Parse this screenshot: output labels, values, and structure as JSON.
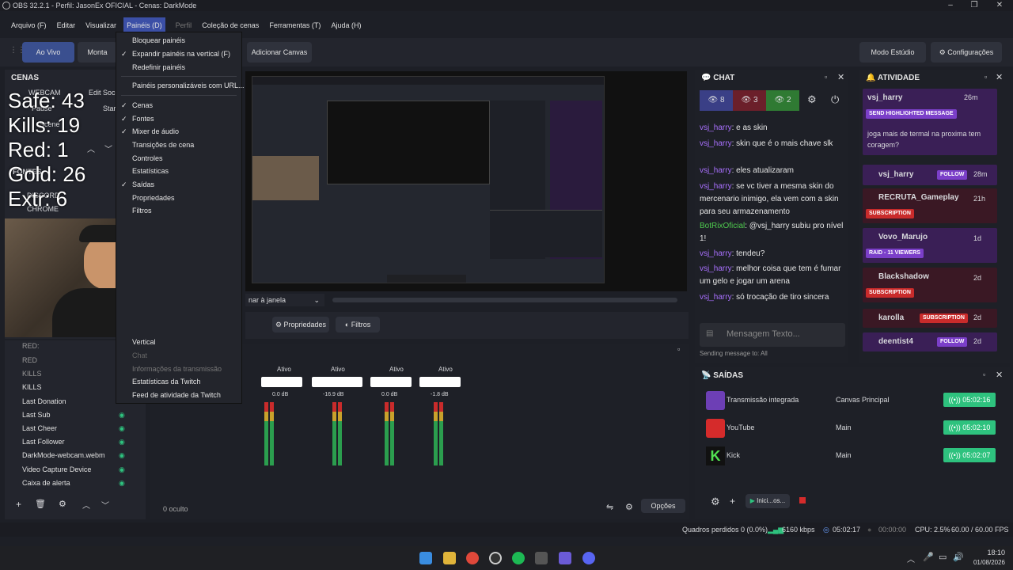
{
  "window": {
    "title": "OBS 32.2.1 - Perfil: JasonEx OFICIAL - Cenas: DarkMode",
    "min": "–",
    "max": "❐",
    "close": "✕"
  },
  "menu": {
    "items": [
      "Arquivo (F)",
      "Editar",
      "Visualizar",
      "Painéis (D)",
      "Perfil",
      "Coleção de cenas",
      "Ferramentas (T)",
      "Ajuda (H)"
    ]
  },
  "toolbar": {
    "live": "Ao Vivo",
    "montage": "Monta",
    "add_canvas": "Adicionar Canvas",
    "studio": "Modo Estúdio",
    "config": "Configurações"
  },
  "dropdown": {
    "items": [
      "Bloquear painéis",
      "Expandir painéis na vertical (F)",
      "Redefinir painéis",
      "Painéis personalizáveis com URL...",
      "Cenas",
      "Fontes",
      "Mixer de áudio",
      "Transições de cena",
      "Controles",
      "Estatísticas",
      "Saídas",
      "Propriedades",
      "Filtros",
      "Vertical",
      "Chat",
      "Informações da transmissão",
      "Estatísticas da Twitch",
      "Feed de atividade da Twitch"
    ]
  },
  "scenes": {
    "title": "CENAS",
    "items": [
      "WEBCAM",
      "Edit Soci",
      "Pause",
      "Star",
      "Scene",
      "FONTES",
      "DISCORD",
      "CHROME"
    ]
  },
  "overlay": {
    "safe": "Safe: 43",
    "kills": "Kills: 19",
    "red": "Red:   1",
    "gold": "Gold: 26",
    "extr": "Extr:  6"
  },
  "sources": {
    "items": [
      "RED:",
      "RED",
      "KILLS",
      "KILLS",
      "Last Donation",
      "Last Sub",
      "Last Cheer",
      "Last Follower",
      "DarkMode-webcam.webm",
      "Video Capture Device",
      "Caixa de alerta"
    ]
  },
  "preview": {
    "window_label": "nar à janela",
    "props": "Propriedades",
    "filters": "Filtros"
  },
  "chat": {
    "title": "CHAT",
    "viewers": [
      "8",
      "3",
      "2"
    ],
    "lines": [
      {
        "user": "vsj_harry",
        "text": ": e as skin"
      },
      {
        "user": "vsj_harry",
        "text": ": skin que é o mais chave slk"
      },
      {
        "user": "vsj_harry",
        "text": ": eles atualizaram"
      },
      {
        "user": "vsj_harry",
        "text": ": se vc tiver a mesma skin do mercenario inimigo, ela vem com a skin para seu armazenamento"
      },
      {
        "user": "BotRixOficial",
        "text": ": @vsj_harry subiu pro nível 1!"
      },
      {
        "user": "vsj_harry",
        "text": ": tendeu?"
      },
      {
        "user": "vsj_harry",
        "text": ": melhor coisa que tem é fumar um gelo e jogar um arena"
      },
      {
        "user": "vsj_harry",
        "text": ": só trocação de tiro sincera"
      }
    ],
    "input_placeholder": "Mensagem Texto...",
    "sending": "Sending message to: All"
  },
  "activity": {
    "title": "ATIVIDADE",
    "items": [
      {
        "user": "vsj_harry",
        "badge": "SEND HIGHLIGHTED MESSAGE",
        "time": "26m",
        "msg": "joga mais de termal na proxima tem coragem?"
      },
      {
        "user": "vsj_harry",
        "badge": "FOLLOW",
        "time": "28m"
      },
      {
        "user": "RECRUTA_Gameplay",
        "badge": "SUBSCRIPTION",
        "time": "21h"
      },
      {
        "user": "Vovo_Marujo",
        "badge": "RAID - 11 VIEWERS",
        "time": "1d"
      },
      {
        "user": "Blackshadow",
        "badge": "SUBSCRIPTION",
        "time": "2d"
      },
      {
        "user": "karolla",
        "badge": "SUBSCRIPTION",
        "time": "2d"
      },
      {
        "user": "deentist4",
        "badge": "FOLLOW",
        "time": "2d"
      }
    ]
  },
  "outputs": {
    "title": "SAÍDAS",
    "rows": [
      {
        "name": "Transmissão integrada",
        "canvas": "Canvas Principal",
        "time": "05:02:16"
      },
      {
        "name": "YouTube",
        "canvas": "Main",
        "time": "05:02:10"
      },
      {
        "name": "Kick",
        "canvas": "Main",
        "time": "05:02:07"
      }
    ],
    "start_label": "Inici...os..."
  },
  "mixer": {
    "strips": [
      {
        "status": "Ativo",
        "db": "0.0 dB"
      },
      {
        "status": "Ativo",
        "db": "-16.9 dB"
      },
      {
        "status": "Ativo",
        "db": "0.0 dB"
      },
      {
        "status": "Ativo",
        "db": "-1.8 dB"
      }
    ],
    "scale": [
      "-5",
      "-12",
      "-18",
      "-24",
      "-30",
      "-36",
      "-42",
      "-48",
      "-54",
      "-60"
    ],
    "hidden": "0 oculto",
    "options": "Opções"
  },
  "status": {
    "frames": "Quadros perdidos 0 (0.0%)",
    "kbps": "6160 kbps",
    "live_time": "05:02:17",
    "rec_time": "00:00:00",
    "cpu": "CPU: 2.5%",
    "fps": "60.00 / 60.00 FPS"
  },
  "clock": {
    "time": "18:10",
    "date": "01/08/2026"
  },
  "colors": {
    "accent": "#3b4fa6",
    "green": "#2ec27e",
    "red": "#c92b2b",
    "twitch": "#a970ff"
  }
}
